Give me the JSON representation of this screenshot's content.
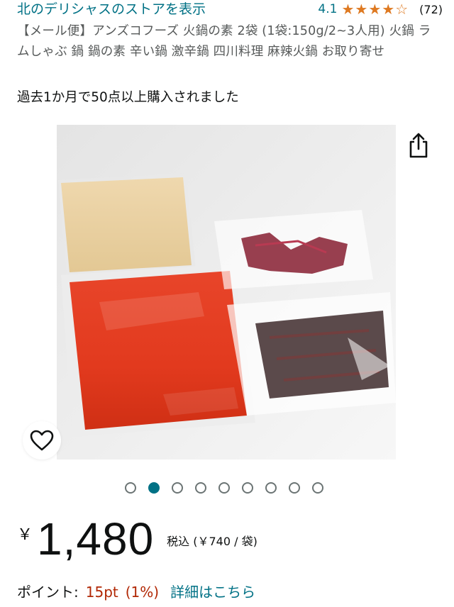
{
  "store": {
    "link_text": "北のデリシャスのストアを表示"
  },
  "rating": {
    "value": "4.1",
    "stars": 4,
    "max": 5,
    "count": "(72)"
  },
  "product": {
    "title": "【メール便】アンズコフーズ 火鍋の素 2袋 (1袋:150g/2~3人用) 火鍋 ラムしゃぶ 鍋 鍋の素 辛い鍋 激辛鍋 四川料理 麻辣火鍋 お取り寄せ",
    "bought_text": "過去1か月で50点以上購入されました"
  },
  "gallery": {
    "total": 9,
    "active_index": 1
  },
  "icons": {
    "share": "share-icon",
    "wishlist": "heart-icon",
    "star": "star-icon"
  },
  "price": {
    "currency": "￥",
    "amount": "1,480",
    "tax_note": "税込 (￥740 / 袋)"
  },
  "points": {
    "label": "ポイント:",
    "value": "15pt",
    "percent": "(1%)",
    "link": "詳細はこちら"
  },
  "colors": {
    "link": "#007185",
    "star": "#de7921",
    "points": "#b12704",
    "text": "#0f1111"
  }
}
